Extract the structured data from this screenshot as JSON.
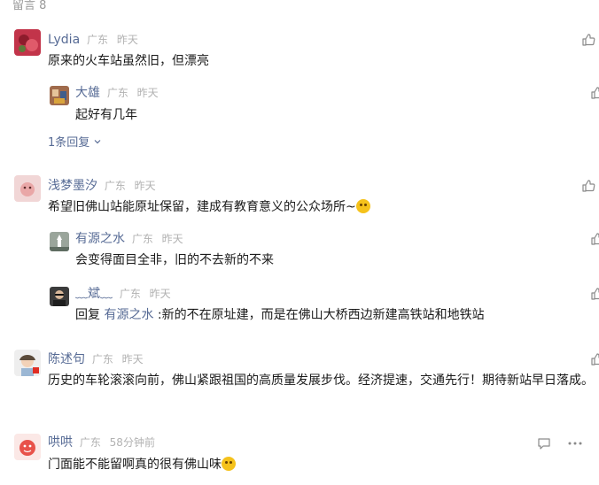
{
  "header": {
    "title": "留言 8"
  },
  "comments": [
    {
      "name": "Lydia",
      "location": "广东",
      "time": "昨天",
      "text": "原来的火车站虽然旧，但漂亮",
      "avatar_color": "#c2344a",
      "replies": [
        {
          "name": "大雄",
          "location": "广东",
          "time": "昨天",
          "text": "起好有几年",
          "avatar_color": "#a06b4c"
        }
      ],
      "more_replies": "1条回复"
    },
    {
      "name": "浅梦墨汐",
      "location": "广东",
      "time": "昨天",
      "text": "希望旧佛山站能原址保留，建成有教育意义的公众场所~",
      "avatar_color": "#f1d6d6",
      "replies": [
        {
          "name": "有源之水",
          "location": "广东",
          "time": "昨天",
          "text": "会变得面目全非，旧的不去新的不来",
          "avatar_color": "#9aa59b"
        },
        {
          "name": "﹏斌﹏",
          "location": "广东",
          "time": "昨天",
          "reply_prefix": "回复",
          "reply_to": "有源之水",
          "text": ":新的不在原址建，而是在佛山大桥西边新建高铁站和地铁站",
          "avatar_color": "#3b3b3b"
        }
      ]
    },
    {
      "name": "陈述句",
      "location": "广东",
      "time": "昨天",
      "text": "历史的车轮滚滚向前，佛山紧跟祖国的高质量发展步伐。经济提速，交通先行！期待新站早日落成。",
      "avatar_color": "#dcdcdc"
    },
    {
      "name": "哄哄",
      "location": "广东",
      "time": "58分钟前",
      "text": "门面能不能留啊真的很有佛山味",
      "avatar_color": "#e8524a"
    }
  ],
  "colors": {
    "name": "#576b95",
    "meta": "#b2b2b2",
    "text": "#1a1a1a",
    "header": "#9a9a9a"
  }
}
